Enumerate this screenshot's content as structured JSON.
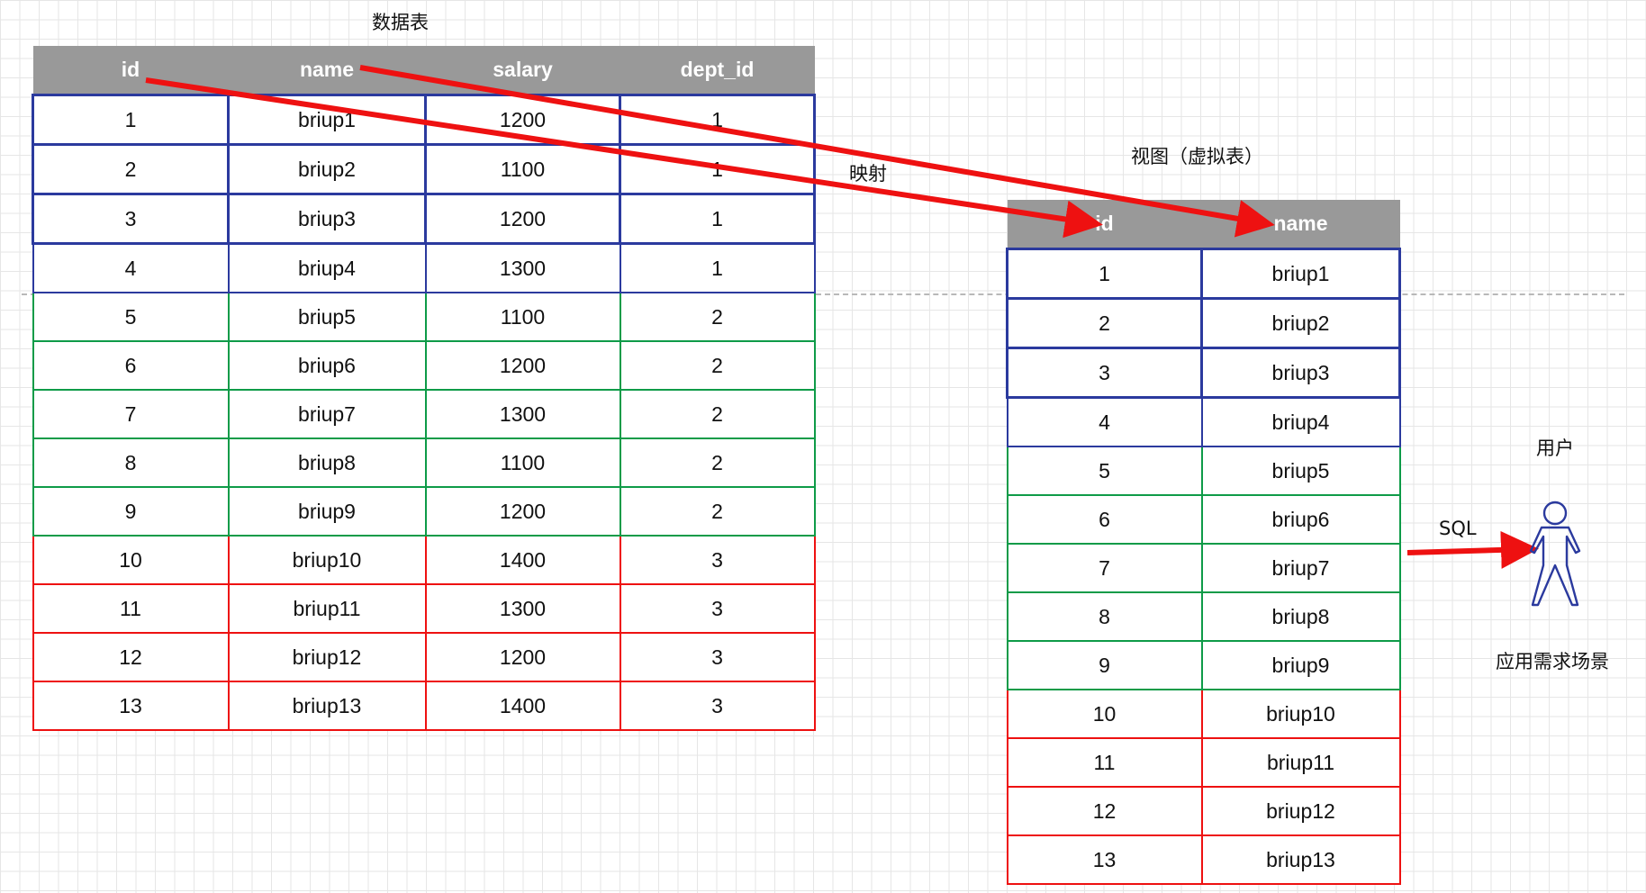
{
  "data_table": {
    "title": "数据表",
    "columns": [
      "id",
      "name",
      "salary",
      "dept_id"
    ],
    "rows": [
      [
        "1",
        "briup1",
        "1200",
        "1"
      ],
      [
        "2",
        "briup2",
        "1100",
        "1"
      ],
      [
        "3",
        "briup3",
        "1200",
        "1"
      ],
      [
        "4",
        "briup4",
        "1300",
        "1"
      ],
      [
        "5",
        "briup5",
        "1100",
        "2"
      ],
      [
        "6",
        "briup6",
        "1200",
        "2"
      ],
      [
        "7",
        "briup7",
        "1300",
        "2"
      ],
      [
        "8",
        "briup8",
        "1100",
        "2"
      ],
      [
        "9",
        "briup9",
        "1200",
        "2"
      ],
      [
        "10",
        "briup10",
        "1400",
        "3"
      ],
      [
        "11",
        "briup11",
        "1300",
        "3"
      ],
      [
        "12",
        "briup12",
        "1200",
        "3"
      ],
      [
        "13",
        "briup13",
        "1400",
        "3"
      ]
    ]
  },
  "view_table": {
    "title": "视图（虚拟表）",
    "columns": [
      "id",
      "name"
    ],
    "rows": [
      [
        "1",
        "briup1"
      ],
      [
        "2",
        "briup2"
      ],
      [
        "3",
        "briup3"
      ],
      [
        "4",
        "briup4"
      ],
      [
        "5",
        "briup5"
      ],
      [
        "6",
        "briup6"
      ],
      [
        "7",
        "briup7"
      ],
      [
        "8",
        "briup8"
      ],
      [
        "9",
        "briup9"
      ],
      [
        "10",
        "briup10"
      ],
      [
        "11",
        "briup11"
      ],
      [
        "12",
        "briup12"
      ],
      [
        "13",
        "briup13"
      ]
    ]
  },
  "mapping_label": "映射",
  "user_label": "用户",
  "sql_label": "SQL",
  "scenario_label": "应用需求场景",
  "colors": {
    "header_bg": "#999999",
    "header_text": "#ffffff",
    "dept1_border": "#2b3a9e",
    "dept2_border": "#0e9b48",
    "dept3_border": "#ee1111",
    "arrow": "#ee1111",
    "figure": "#2b3a9e"
  },
  "icons": {
    "user": "stick-figure-icon"
  }
}
